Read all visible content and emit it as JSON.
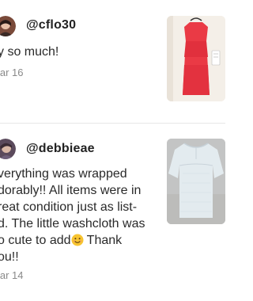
{
  "reviews": [
    {
      "username": "@cflo30",
      "text": "y so much!",
      "date": "lar 16",
      "avatar_icon": "user-avatar-icon",
      "photo_icon": "red-dress-photo",
      "photo_color": "#e8323e"
    },
    {
      "username": "@debbieae",
      "text_before_emoji": "verything was wrapped\ndorably!! All items were in\nreat condition just as list-\nd. The little washcloth was\no cute to add",
      "emoji": "smiling-face-emoji",
      "text_after_emoji": " Thank\nou!!",
      "date": "lar 14",
      "avatar_icon": "user-avatar-icon",
      "photo_icon": "white-blouse-photo",
      "photo_color": "#dfe6ea"
    }
  ]
}
